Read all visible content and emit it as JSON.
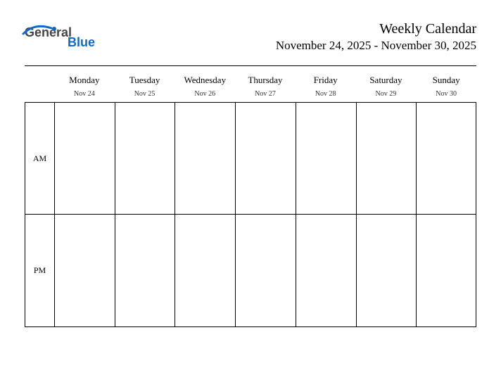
{
  "logo": {
    "word1": "General",
    "word2": "Blue"
  },
  "header": {
    "title": "Weekly Calendar",
    "date_range": "November 24, 2025 - November 30, 2025"
  },
  "row_labels": {
    "am": "AM",
    "pm": "PM"
  },
  "days": [
    {
      "name": "Monday",
      "date": "Nov 24"
    },
    {
      "name": "Tuesday",
      "date": "Nov 25"
    },
    {
      "name": "Wednesday",
      "date": "Nov 26"
    },
    {
      "name": "Thursday",
      "date": "Nov 27"
    },
    {
      "name": "Friday",
      "date": "Nov 28"
    },
    {
      "name": "Saturday",
      "date": "Nov 29"
    },
    {
      "name": "Sunday",
      "date": "Nov 30"
    }
  ]
}
